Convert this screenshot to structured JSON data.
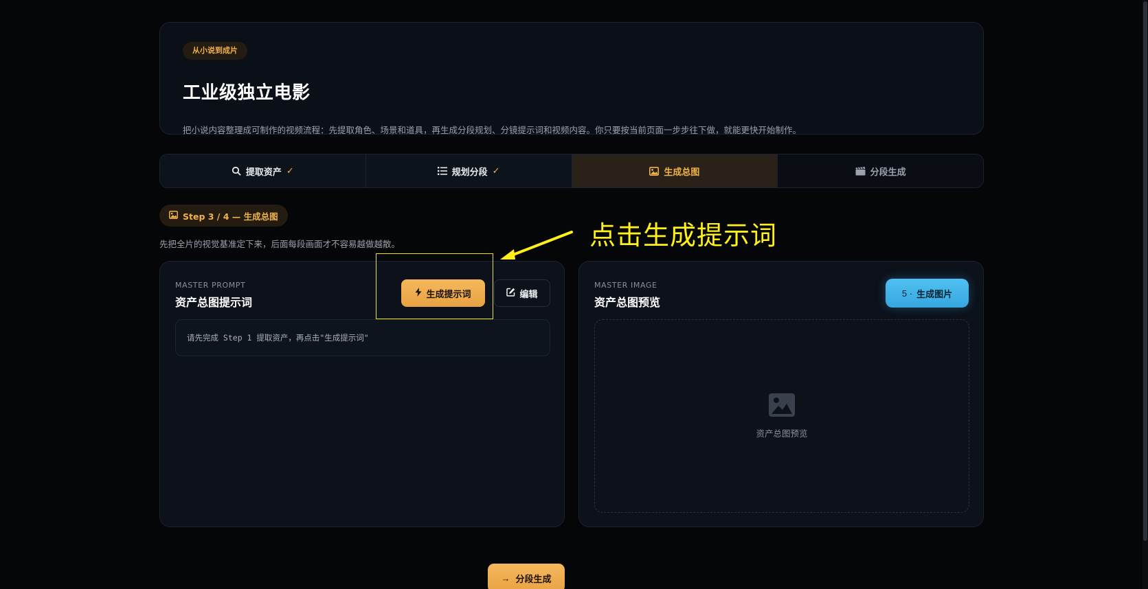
{
  "hero": {
    "badge": "从小说到成片",
    "title": "工业级独立电影",
    "description": "把小说内容整理成可制作的视频流程：先提取角色、场景和道具，再生成分段规划、分镜提示词和视频内容。你只要按当前页面一步步往下做，就能更快开始制作。"
  },
  "tabs": [
    {
      "label": "提取资产",
      "icon": "search-icon",
      "done": "✓"
    },
    {
      "label": "规划分段",
      "icon": "list-icon",
      "done": "✓"
    },
    {
      "label": "生成总图",
      "icon": "image-icon",
      "active": true
    },
    {
      "label": "分段生成",
      "icon": "clapperboard-icon"
    }
  ],
  "step": {
    "pill": "Step 3 / 4 — 生成总图",
    "description": "先把全片的视觉基准定下来，后面每段画面才不容易越做越散。"
  },
  "annotation": {
    "text": "点击生成提示词",
    "color": "#ffef1a"
  },
  "prompt_panel": {
    "kicker": "MASTER PROMPT",
    "title": "资产总图提示词",
    "generate_label": "生成提示词",
    "edit_label": "编辑",
    "placeholder_text": "请先完成 Step 1 提取资产，再点击\"生成提示词\""
  },
  "image_panel": {
    "kicker": "MASTER IMAGE",
    "title": "资产总图预览",
    "generate_prefix": "5 ·",
    "generate_label": "生成图片",
    "preview_label": "资产总图预览"
  },
  "next_button": {
    "arrow": "→",
    "label": "分段生成"
  },
  "colors": {
    "accent": "#f0b24c",
    "info": "#36a8e0",
    "background": "#050608"
  }
}
